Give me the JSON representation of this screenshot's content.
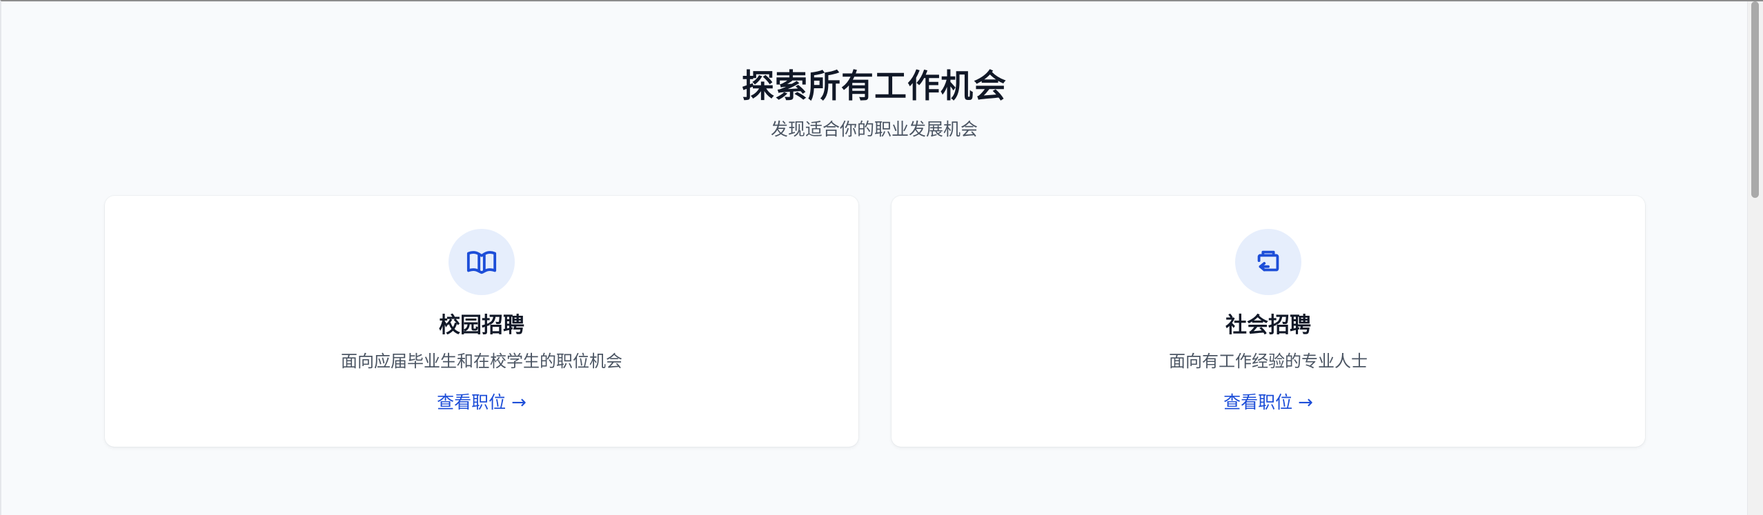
{
  "section": {
    "title": "探索所有工作机会",
    "subtitle": "发现适合你的职业发展机会"
  },
  "cards": [
    {
      "icon": "book-icon",
      "title": "校园招聘",
      "description": "面向应届毕业生和在校学生的职位机会",
      "link_label": "查看职位",
      "link_arrow": "→"
    },
    {
      "icon": "briefcase-icon",
      "title": "社会招聘",
      "description": "面向有工作经验的专业人士",
      "link_label": "查看职位",
      "link_arrow": "→"
    }
  ],
  "colors": {
    "accent": "#1d4ed8",
    "icon_bg": "#e6eefc",
    "page_bg": "#f8fafc",
    "title": "#111827",
    "muted_text": "#4b5563"
  }
}
